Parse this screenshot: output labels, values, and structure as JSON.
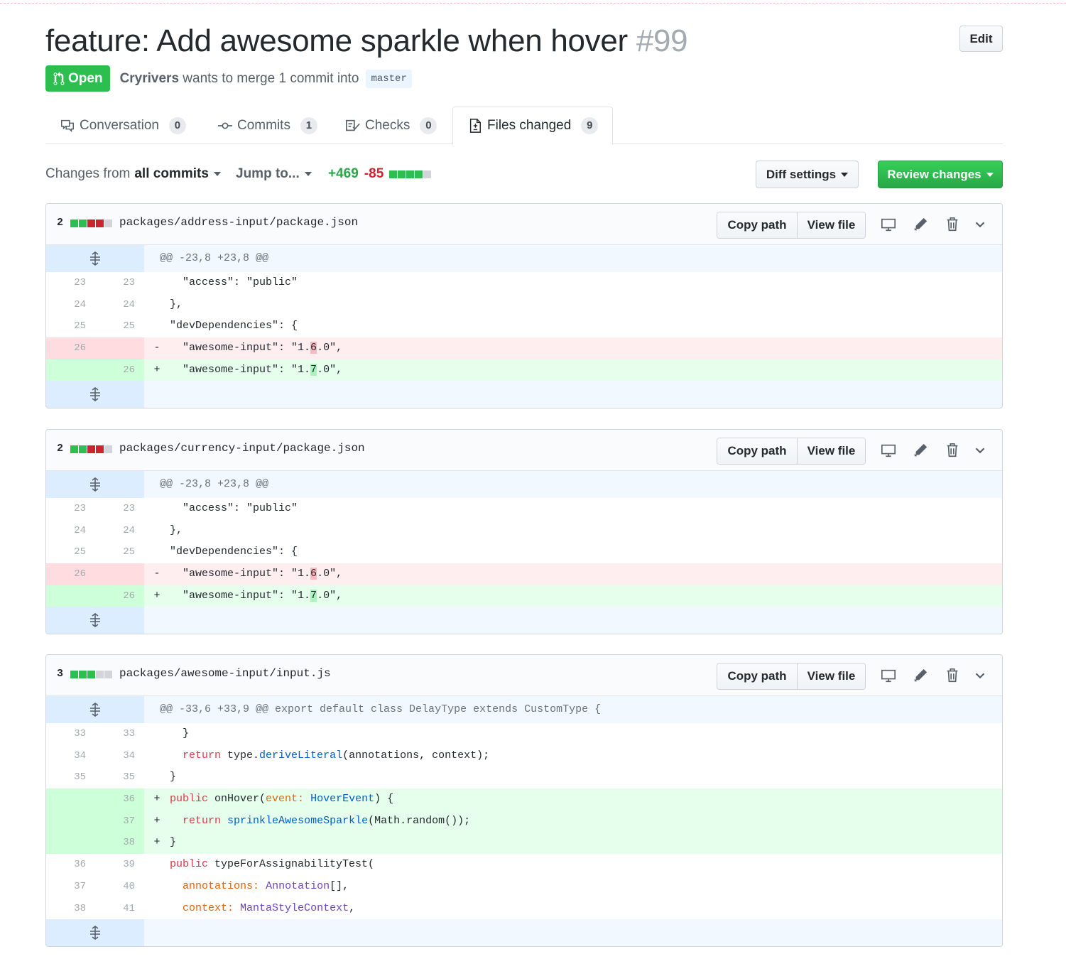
{
  "pr": {
    "title": "feature: Add awesome sparkle when hover",
    "number": "#99",
    "edit_label": "Edit",
    "status": "Open",
    "author": "Cryrivers",
    "merge_text": "wants to merge 1 commit into",
    "base_branch": "master"
  },
  "tabs": [
    {
      "label": "Conversation",
      "count": "0",
      "icon": "comment-icon"
    },
    {
      "label": "Commits",
      "count": "1",
      "icon": "commit-icon"
    },
    {
      "label": "Checks",
      "count": "0",
      "icon": "checks-icon"
    },
    {
      "label": "Files changed",
      "count": "9",
      "icon": "file-diff-icon",
      "selected": true
    }
  ],
  "toolbar": {
    "changes_from": "Changes from",
    "commits_filter": "all commits",
    "jump_to": "Jump to...",
    "additions": "+469",
    "deletions": "-85",
    "diff_settings": "Diff settings",
    "review_changes": "Review changes"
  },
  "file_actions": {
    "copy_path": "Copy path",
    "view_file": "View file"
  },
  "colors": {
    "open_green": "#2cbe4e",
    "addition": "#28a745",
    "deletion": "#cb2431",
    "add_bg": "#e6ffed",
    "del_bg": "#ffeef0",
    "hunk_bg": "#f1f8ff"
  },
  "files": [
    {
      "count": "2",
      "blocks": [
        "g",
        "g",
        "r",
        "r",
        "n"
      ],
      "path": "packages/address-input/package.json",
      "hunk": "@@ -23,8 +23,8 @@",
      "lines": [
        {
          "type": "ctx",
          "old": "23",
          "new": "23",
          "sign": "",
          "code": "  \"access\": \"public\""
        },
        {
          "type": "ctx",
          "old": "24",
          "new": "24",
          "sign": "",
          "code": "},"
        },
        {
          "type": "ctx",
          "old": "25",
          "new": "25",
          "sign": "",
          "code": "\"devDependencies\": {"
        },
        {
          "type": "del",
          "old": "26",
          "new": "",
          "sign": "-",
          "pre": "  \"awesome-input\": \"1.",
          "hl": "6",
          "post": ".0\","
        },
        {
          "type": "add",
          "old": "",
          "new": "26",
          "sign": "+",
          "pre": "  \"awesome-input\": \"1.",
          "hl": "7",
          "post": ".0\","
        }
      ]
    },
    {
      "count": "2",
      "blocks": [
        "g",
        "g",
        "r",
        "r",
        "n"
      ],
      "path": "packages/currency-input/package.json",
      "hunk": "@@ -23,8 +23,8 @@",
      "lines": [
        {
          "type": "ctx",
          "old": "23",
          "new": "23",
          "sign": "",
          "code": "  \"access\": \"public\""
        },
        {
          "type": "ctx",
          "old": "24",
          "new": "24",
          "sign": "",
          "code": "},"
        },
        {
          "type": "ctx",
          "old": "25",
          "new": "25",
          "sign": "",
          "code": "\"devDependencies\": {"
        },
        {
          "type": "del",
          "old": "26",
          "new": "",
          "sign": "-",
          "pre": "  \"awesome-input\": \"1.",
          "hl": "6",
          "post": ".0\","
        },
        {
          "type": "add",
          "old": "",
          "new": "26",
          "sign": "+",
          "pre": "  \"awesome-input\": \"1.",
          "hl": "7",
          "post": ".0\","
        }
      ]
    },
    {
      "count": "3",
      "blocks": [
        "g",
        "g",
        "g",
        "n",
        "n"
      ],
      "path": "packages/awesome-input/input.js",
      "hunk": "@@ -33,6 +33,9 @@ export default class DelayType extends CustomType {",
      "lines": [
        {
          "type": "ctx",
          "old": "33",
          "new": "33",
          "sign": "",
          "tokens": [
            [
              "  }",
              ""
            ]
          ]
        },
        {
          "type": "ctx",
          "old": "34",
          "new": "34",
          "sign": "",
          "tokens": [
            [
              "  ",
              ""
            ],
            [
              "return",
              "kw"
            ],
            [
              " type.",
              ""
            ],
            [
              "deriveLiteral",
              "ty"
            ],
            [
              "(annotations, context);",
              ""
            ]
          ]
        },
        {
          "type": "ctx",
          "old": "35",
          "new": "35",
          "sign": "",
          "tokens": [
            [
              "}",
              ""
            ]
          ]
        },
        {
          "type": "add",
          "old": "",
          "new": "36",
          "sign": "+",
          "tokens": [
            [
              "public",
              "kw"
            ],
            [
              " onHover(",
              ""
            ],
            [
              "event:",
              "pa"
            ],
            [
              " ",
              ""
            ],
            [
              "HoverEvent",
              "ty"
            ],
            [
              ") {",
              ""
            ]
          ]
        },
        {
          "type": "add",
          "old": "",
          "new": "37",
          "sign": "+",
          "tokens": [
            [
              "  ",
              ""
            ],
            [
              "return",
              "kw"
            ],
            [
              " ",
              ""
            ],
            [
              "sprinkleAwesomeSparkle",
              "ty"
            ],
            [
              "(Math.random());",
              ""
            ]
          ]
        },
        {
          "type": "add",
          "old": "",
          "new": "38",
          "sign": "+",
          "tokens": [
            [
              "}",
              ""
            ]
          ]
        },
        {
          "type": "ctx",
          "old": "36",
          "new": "39",
          "sign": "",
          "tokens": [
            [
              "public",
              "kw"
            ],
            [
              " typeForAssignabilityTest(",
              ""
            ]
          ]
        },
        {
          "type": "ctx",
          "old": "37",
          "new": "40",
          "sign": "",
          "tokens": [
            [
              "  ",
              ""
            ],
            [
              "annotations:",
              "pa"
            ],
            [
              " ",
              ""
            ],
            [
              "Annotation",
              "fn"
            ],
            [
              "[],",
              ""
            ]
          ]
        },
        {
          "type": "ctx",
          "old": "38",
          "new": "41",
          "sign": "",
          "tokens": [
            [
              "  ",
              ""
            ],
            [
              "context:",
              "pa"
            ],
            [
              " ",
              ""
            ],
            [
              "MantaStyleContext",
              "fn"
            ],
            [
              ",",
              ""
            ]
          ]
        }
      ]
    }
  ]
}
